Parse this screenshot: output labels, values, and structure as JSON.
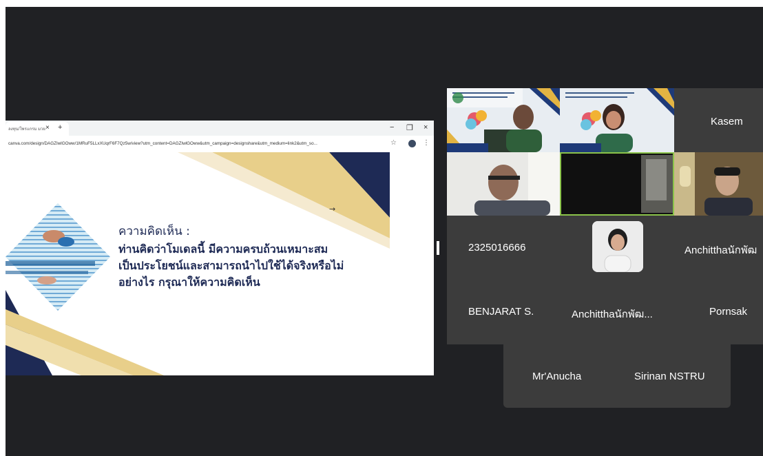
{
  "browser": {
    "tab_title": "ลงทุน/โพรแกรม มวย",
    "tab_close": "×",
    "new_tab": "+",
    "minimize": "−",
    "restore": "❐",
    "close": "×",
    "url": "canva.com/design/DAGZIwlGOww/1MRuF5LLxXUqrF6F7Qz5w/view?utm_content=DAGZIwlGOww&utm_campaign=designshare&utm_medium=link2&utm_so...",
    "star": "☆",
    "menu": "⋮"
  },
  "slide": {
    "arrow": "→",
    "title": "ความคิดเห็น :",
    "lines": [
      "ท่านคิดว่าโมเดลนี้ มีความครบถ้วนเหมาะสม",
      "เป็นประโยชน์และสามารถนำไปใช้ได้จริงหรือไม่",
      "อย่างไร กรุณาให้ความคิดเห็น"
    ]
  },
  "participants": {
    "kasem": "Kasem",
    "p2325": "2325016666",
    "anchittha1": "Anchitthaนักพัฒ",
    "benjarat": "BENJARAT S.",
    "anchittha2": "Anchitthaนักพัฒ...",
    "pornsak": "Pornsak",
    "anucha": "Mr'Anucha",
    "sirinan": "Sirinan NSTRU"
  },
  "colors": {
    "meeting_bg": "#202124",
    "tile_bg": "#3c3c3c",
    "active_speaker": "#8bc34a",
    "slide_navy": "#1e2a55",
    "slide_gold": "#e8cf8a"
  }
}
